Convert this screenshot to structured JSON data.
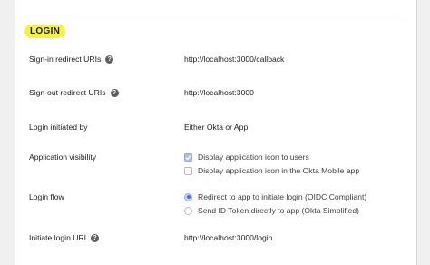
{
  "section": {
    "title": "LOGIN"
  },
  "rows": {
    "signin": {
      "label": "Sign-in redirect URIs",
      "value": "http://localhost:3000/callback",
      "help_icon": "question-circle-icon"
    },
    "signout": {
      "label": "Sign-out redirect URIs",
      "value": "http://localhost:3000",
      "help_icon": "question-circle-icon"
    },
    "initiated": {
      "label": "Login initiated by",
      "value": "Either Okta or App"
    },
    "visibility": {
      "label": "Application visibility",
      "options": [
        {
          "label": "Display application icon to users",
          "checked": true
        },
        {
          "label": "Display application icon in the Okta Mobile app",
          "checked": false
        }
      ]
    },
    "flow": {
      "label": "Login flow",
      "options": [
        {
          "label": "Redirect to app to initiate login (OIDC Compliant)",
          "selected": true
        },
        {
          "label": "Send ID Token directly to app (Okta Simplified)",
          "selected": false
        }
      ]
    },
    "initiate_uri": {
      "label": "Initiate login URI",
      "value": "http://localhost:3000/login",
      "help_icon": "question-circle-icon"
    }
  },
  "colors": {
    "highlight": "#f7f23a",
    "accent": "#4a6fe0"
  }
}
